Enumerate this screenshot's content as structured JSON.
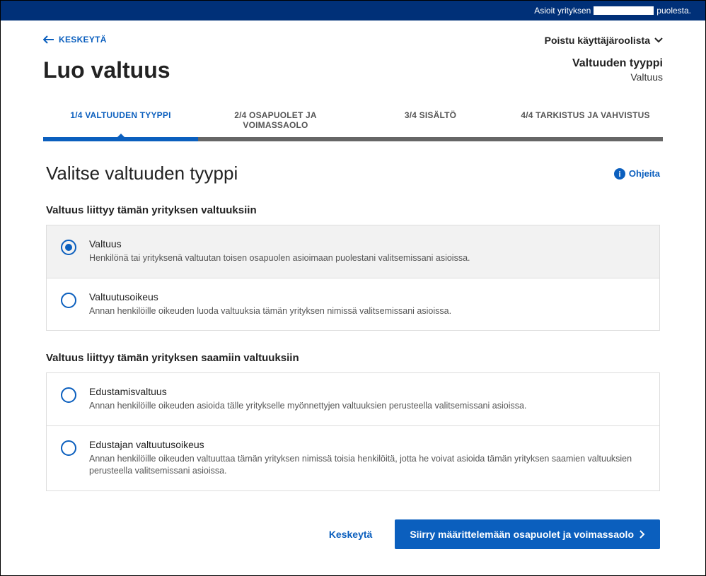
{
  "top_bar": {
    "prefix": "Asioit yrityksen",
    "suffix": "puolesta."
  },
  "header": {
    "back_link": "KESKEYTÄ",
    "role_dropdown": "Poistu käyttäjäroolista",
    "page_title": "Luo valtuus",
    "side_title_big": "Valtuuden tyyppi",
    "side_title_small": "Valtuus"
  },
  "stepper": {
    "steps": [
      "1/4 VALTUUDEN TYYPPI",
      "2/4 OSAPUOLET JA VOIMASSAOLO",
      "3/4 SISÄLTÖ",
      "4/4 TARKISTUS JA VAHVISTUS"
    ],
    "active_index": 0
  },
  "form": {
    "title": "Valitse valtuuden tyyppi",
    "help_label": "Ohjeita",
    "section1_label": "Valtuus liittyy tämän yrityksen valtuuksiin",
    "section2_label": "Valtuus liittyy tämän yrityksen saamiin valtuuksiin",
    "options_a": [
      {
        "title": "Valtuus",
        "desc": "Henkilönä tai yrityksenä valtuutan toisen osapuolen asioimaan puolestani valitsemissani asioissa.",
        "selected": true
      },
      {
        "title": "Valtuutusoikeus",
        "desc": "Annan henkilöille oikeuden luoda valtuuksia tämän yrityksen nimissä valitsemissani asioissa.",
        "selected": false
      }
    ],
    "options_b": [
      {
        "title": "Edustamisvaltuus",
        "desc": "Annan henkilöille oikeuden asioida tälle yritykselle myönnettyjen valtuuksien perusteella valitsemissani asioissa.",
        "selected": false
      },
      {
        "title": "Edustajan valtuutusoikeus",
        "desc": "Annan henkilöille oikeuden valtuuttaa tämän yrityksen nimissä toisia henkilöitä, jotta he voivat asioida tämän yrityksen saamien valtuuksien perusteella valitsemissani asioissa.",
        "selected": false
      }
    ]
  },
  "footer": {
    "cancel": "Keskeytä",
    "next": "Siirry määrittelemään osapuolet ja voimassaolo"
  }
}
